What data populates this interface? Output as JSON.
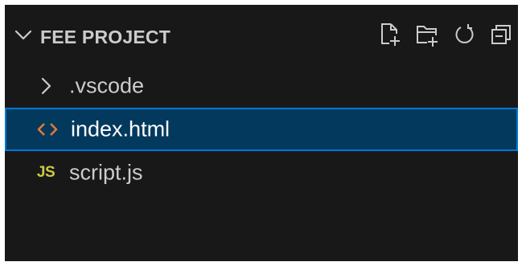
{
  "explorer": {
    "section_title": "FEE PROJECT",
    "actions": [
      {
        "name": "new-file",
        "icon": "new-file-icon"
      },
      {
        "name": "new-folder",
        "icon": "new-folder-icon"
      },
      {
        "name": "refresh",
        "icon": "refresh-icon"
      },
      {
        "name": "collapse-all",
        "icon": "collapse-all-icon"
      }
    ],
    "items": [
      {
        "label": ".vscode",
        "type": "folder",
        "icon": "chevron-right-icon",
        "selected": false
      },
      {
        "label": "index.html",
        "type": "file",
        "icon": "html-file-icon",
        "selected": true
      },
      {
        "label": "script.js",
        "type": "file",
        "icon": "js-file-icon",
        "badge": "JS",
        "selected": false
      }
    ]
  },
  "colors": {
    "background": "#181818",
    "text": "#cccccc",
    "selection_bg": "#04395e",
    "selection_border": "#0078d4",
    "html_icon": "#e37933",
    "js_icon": "#cbcb41"
  }
}
